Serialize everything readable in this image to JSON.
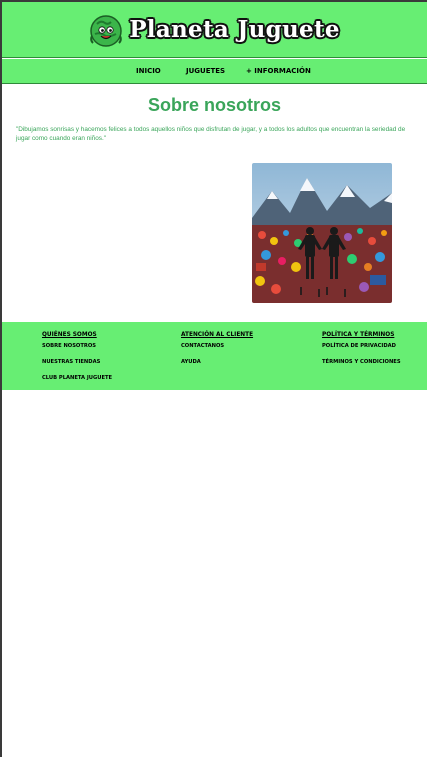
{
  "header": {
    "brand": "Planeta Juguete",
    "logo_icon": "planet-mascot-icon"
  },
  "nav": {
    "items": [
      {
        "label": "INICIO"
      },
      {
        "label": "JUGUETES"
      },
      {
        "label": "+ INFORMACIÓN"
      }
    ]
  },
  "main": {
    "title": "Sobre nosotros",
    "quote": "\"Dibujamos sonrisas y hacemos felices a todos aquellos niños que disfrutan de jugar, y a todos los adultos que encuentran la seriedad de jugar como cuando eran niños.\"",
    "image_icon": "toy-mountain-illustration"
  },
  "footer": {
    "columns": [
      {
        "heading": "QUIÉNES SOMOS",
        "links": [
          "SOBRE NOSOTROS",
          "NUESTRAS TIENDAS",
          "CLUB PLANETA JUGUETE"
        ]
      },
      {
        "heading": "ATENCIÓN AL CLIENTE",
        "links": [
          "CONTACTANOS",
          "AYUDA"
        ]
      },
      {
        "heading": "POLÍTICA Y TÉRMINOS",
        "links": [
          "POLÍTICA DE PRIVACIDAD",
          "TÉRMINOS Y CONDICIONES"
        ]
      }
    ]
  },
  "colors": {
    "green": "#67ee73",
    "title_green": "#3aa55a"
  }
}
